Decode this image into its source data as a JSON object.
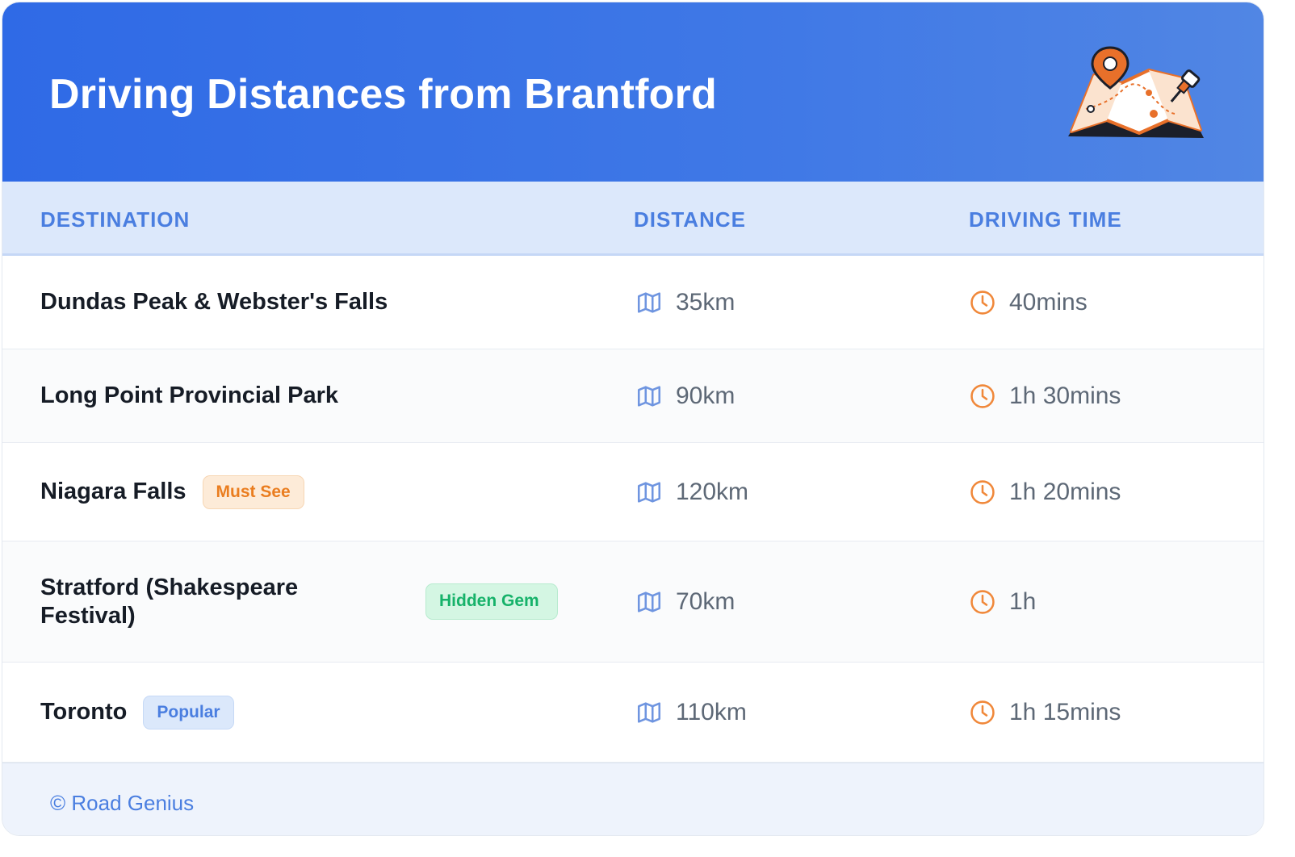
{
  "header": {
    "title": "Driving Distances from Brantford"
  },
  "table": {
    "columns": [
      "DESTINATION",
      "DISTANCE",
      "DRIVING TIME"
    ],
    "rows": [
      {
        "destination": "Dundas Peak & Webster's Falls",
        "badge": null,
        "distance": "35km",
        "time": "40mins"
      },
      {
        "destination": "Long Point Provincial Park",
        "badge": null,
        "distance": "90km",
        "time": "1h 30mins"
      },
      {
        "destination": "Niagara Falls",
        "badge": "Must See",
        "distance": "120km",
        "time": "1h 20mins"
      },
      {
        "destination": "Stratford (Shakespeare Festival)",
        "badge": "Hidden Gem",
        "distance": "70km",
        "time": "1h"
      },
      {
        "destination": "Toronto",
        "badge": "Popular",
        "distance": "110km",
        "time": "1h 15mins"
      }
    ]
  },
  "icons": {
    "distance": "map-icon",
    "time": "clock-icon",
    "header": "map-pin-illustration"
  },
  "colors": {
    "header_start": "#2f6ae6",
    "accent_blue": "#4a7ee0",
    "accent_orange": "#ea7d1f",
    "accent_green": "#16b26a"
  },
  "footer": {
    "credit": "© Road Genius"
  }
}
